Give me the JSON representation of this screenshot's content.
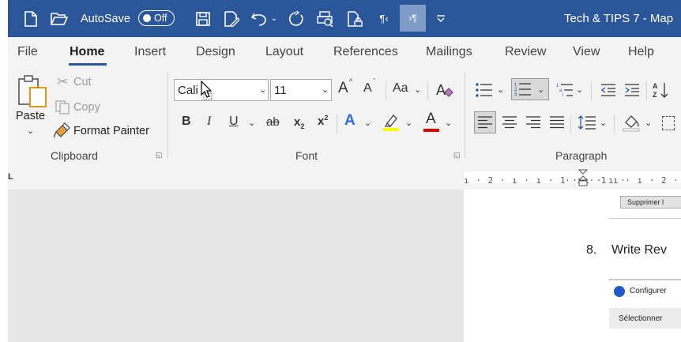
{
  "titlebar": {
    "autosave_label": "AutoSave",
    "autosave_state": "Off",
    "doc_title": "Tech & TIPS 7 - Map",
    "accent": "#2b579a"
  },
  "tabs": [
    "File",
    "Home",
    "Insert",
    "Design",
    "Layout",
    "References",
    "Mailings",
    "Review",
    "View",
    "Help"
  ],
  "active_tab": "Home",
  "clipboard": {
    "paste": "Paste",
    "cut": "Cut",
    "copy": "Copy",
    "format_painter": "Format Painter",
    "group_label": "Clipboard"
  },
  "font": {
    "font_name": "Cali",
    "font_size": "11",
    "grow": "A",
    "shrink": "A",
    "change_case": "Aa",
    "bold": "B",
    "italic": "I",
    "underline": "U",
    "strike": "ab",
    "subscript": "x",
    "superscript": "x",
    "sub_index": "2",
    "sup_index": "2",
    "text_effects": "A",
    "font_color": "A",
    "group_label": "Font",
    "highlight_color": "#ffff00",
    "font_color_value": "#e00000"
  },
  "paragraph": {
    "group_label": "Paragraph"
  },
  "ruler": {
    "left_marks": "ı · 2 · ı · ı · 1 · ı · ı ·",
    "right_marks": "· ı · 1 ı · ı · 2 · ı ·"
  },
  "document": {
    "button_snippet": "Supprimer l",
    "list_number": "8.",
    "list_text": "Write Rev",
    "configure_text": "Configurer",
    "select_text": "Sélectionner"
  }
}
